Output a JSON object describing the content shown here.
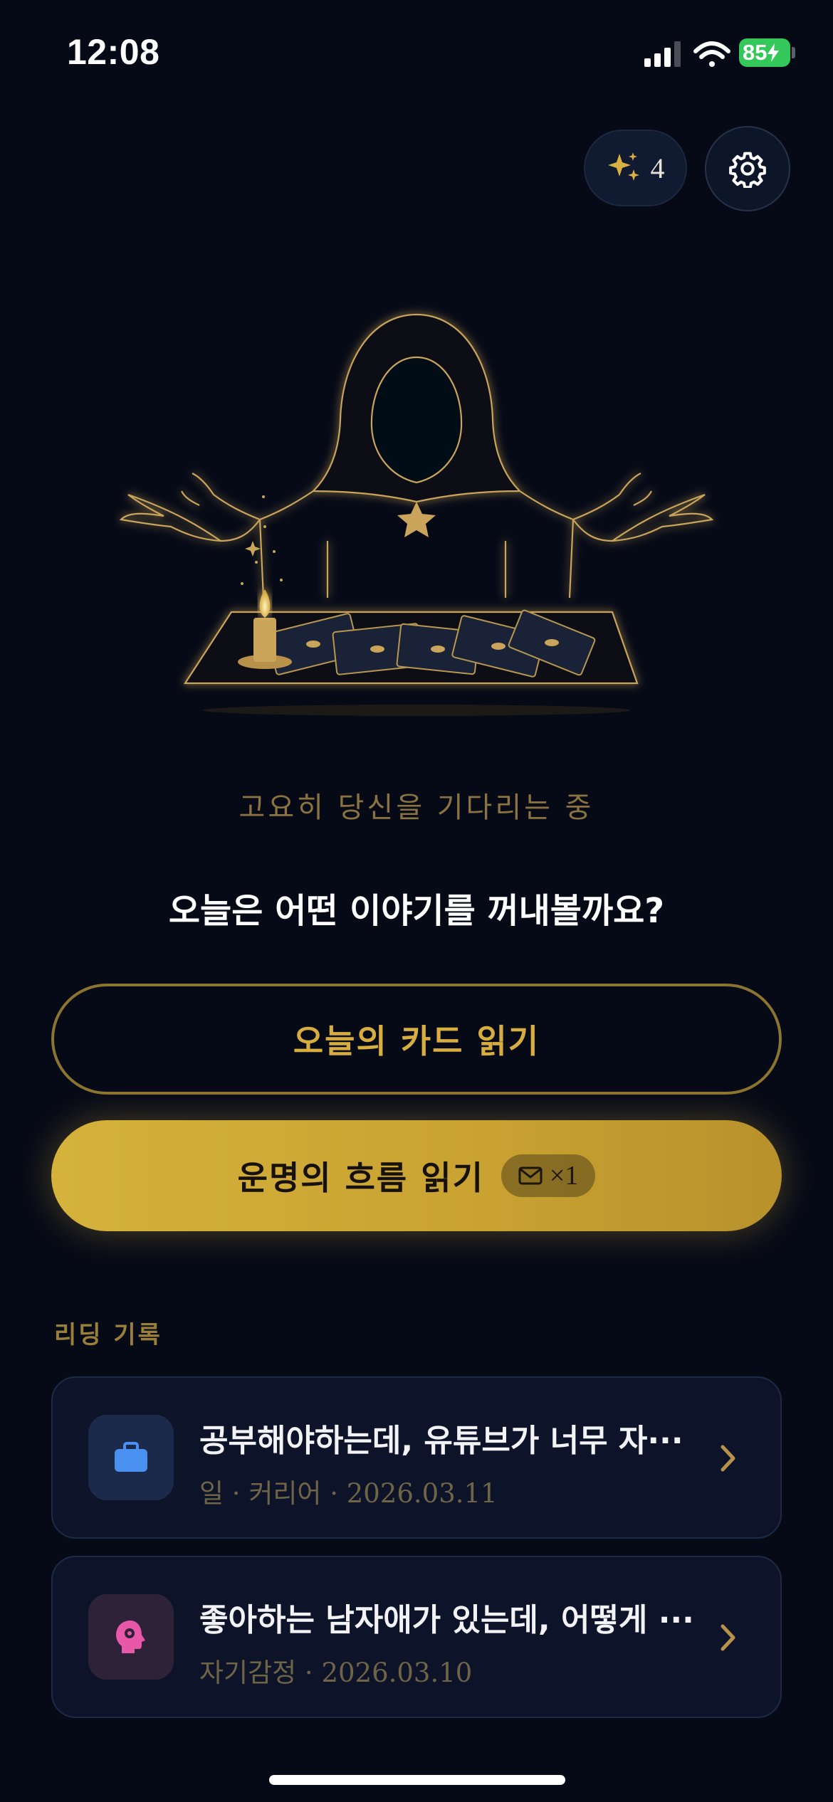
{
  "status_bar": {
    "time": "12:08",
    "battery": "85"
  },
  "header": {
    "credits_count": "4"
  },
  "hero": {
    "subtitle": "고요히 당신을 기다리는 중",
    "question": "오늘은 어떤 이야기를 꺼내볼까요?"
  },
  "actions": {
    "daily_card_label": "오늘의 카드 읽기",
    "fortune_flow_label": "운명의 흐름 읽기",
    "ticket_count": "×1"
  },
  "history": {
    "title": "리딩 기록",
    "items": [
      {
        "title": "공부해야하는데, 유튜브가 너무 자···",
        "meta": "일 · 커리어 · 2026.03.11",
        "icon": "briefcase-icon",
        "icon_color": "#4a90f0",
        "icon_bg": "#1b2a4a"
      },
      {
        "title": "좋아하는 남자애가 있는데, 어떻게 ···",
        "meta": "자기감정 · 2026.03.10",
        "icon": "head-heart-icon",
        "icon_color": "#e858a8",
        "icon_bg": "#2e2238"
      }
    ]
  },
  "colors": {
    "background": "#060a17",
    "gold": "#d6ad3e",
    "gold_dim": "#8a742f"
  }
}
